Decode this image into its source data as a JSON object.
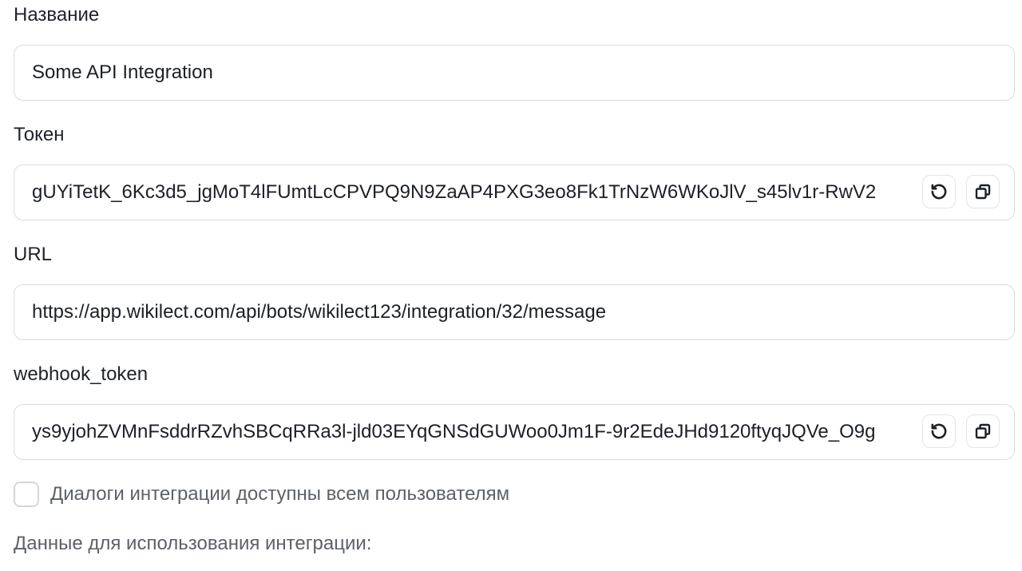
{
  "form": {
    "name": {
      "label": "Название",
      "value": "Some API Integration"
    },
    "token": {
      "label": "Токен",
      "value": "gUYiTetK_6Kc3d5_jgMoT4lFUmtLcCPVPQ9N9ZaAP4PXG3eo8Fk1TrNzW6WKoJlV_s45lv1r-RwV2",
      "actions": [
        "refresh-icon",
        "copy-icon"
      ]
    },
    "url": {
      "label": "URL",
      "value": "https://app.wikilect.com/api/bots/wikilect123/integration/32/message"
    },
    "webhook_token": {
      "label": "webhook_token",
      "value": "ys9yjohZVMnFsddrRZvhSBCqRRa3l-jld03EYqGNSdGUWoo0Jm1F-9r2EdeJHd9120ftyqJQVe_O9g",
      "actions": [
        "refresh-icon",
        "copy-icon"
      ]
    },
    "dialogs_checkbox": {
      "label": "Диалоги интеграции доступны всем пользователям",
      "checked": false
    },
    "usage_section": {
      "title": "Данные для использования интеграции:"
    }
  }
}
